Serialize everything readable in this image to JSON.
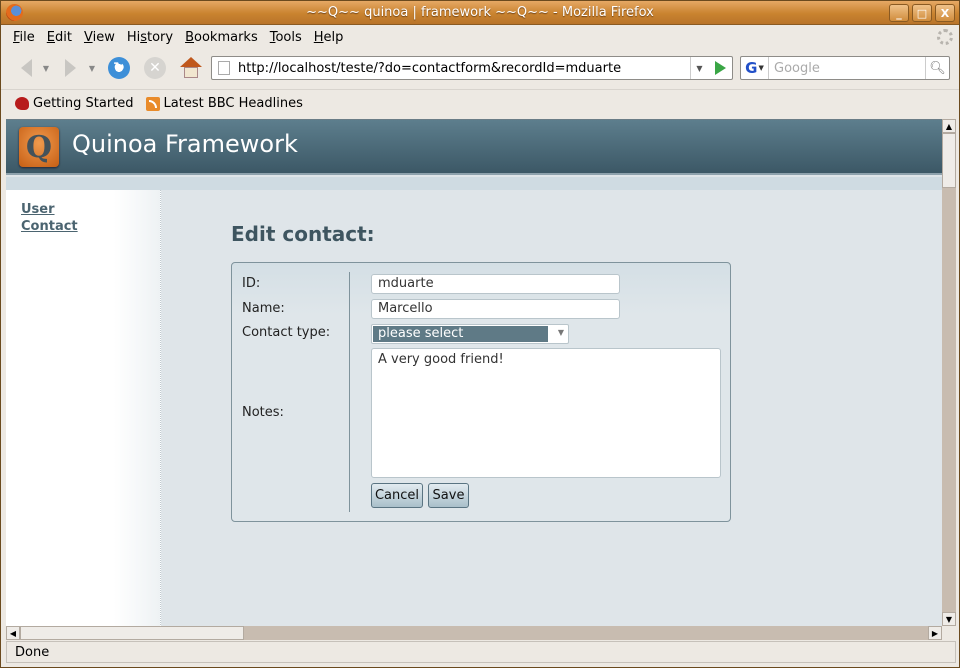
{
  "window": {
    "title": "~~Q~~ quinoa | framework ~~Q~~ - Mozilla Firefox",
    "controls": {
      "minimize": "_",
      "maximize": "□",
      "close": "X"
    }
  },
  "menu": [
    {
      "key": "F",
      "rest": "ile"
    },
    {
      "key": "E",
      "rest": "dit"
    },
    {
      "key": "V",
      "rest": "iew"
    },
    {
      "pre": "Hi",
      "key": "s",
      "rest": "tory"
    },
    {
      "key": "B",
      "rest": "ookmarks"
    },
    {
      "key": "T",
      "rest": "ools"
    },
    {
      "key": "H",
      "rest": "elp"
    }
  ],
  "navigation": {
    "url": "http://localhost/teste/?do=contactform&recordId=mduarte",
    "search_placeholder": "Google",
    "search_engine_letter": "G"
  },
  "bookmarks": [
    {
      "label": "Getting Started",
      "icon": "getting-started-icon"
    },
    {
      "label": "Latest BBC Headlines",
      "icon": "rss-icon"
    }
  ],
  "site": {
    "logo_letter": "Q",
    "title": "Quinoa Framework"
  },
  "sidebar": {
    "links": [
      {
        "label": "User"
      },
      {
        "label": "Contact"
      }
    ]
  },
  "form": {
    "heading": "Edit contact:",
    "fields": {
      "id": {
        "label": "ID:",
        "value": "mduarte"
      },
      "name": {
        "label": "Name:",
        "value": "Marcello"
      },
      "contact_type": {
        "label": "Contact type:",
        "selected": "please select"
      },
      "notes": {
        "label": "Notes:",
        "value": "A very good friend!"
      }
    },
    "buttons": {
      "cancel": "Cancel",
      "save": "Save"
    }
  },
  "status": {
    "text": "Done"
  }
}
